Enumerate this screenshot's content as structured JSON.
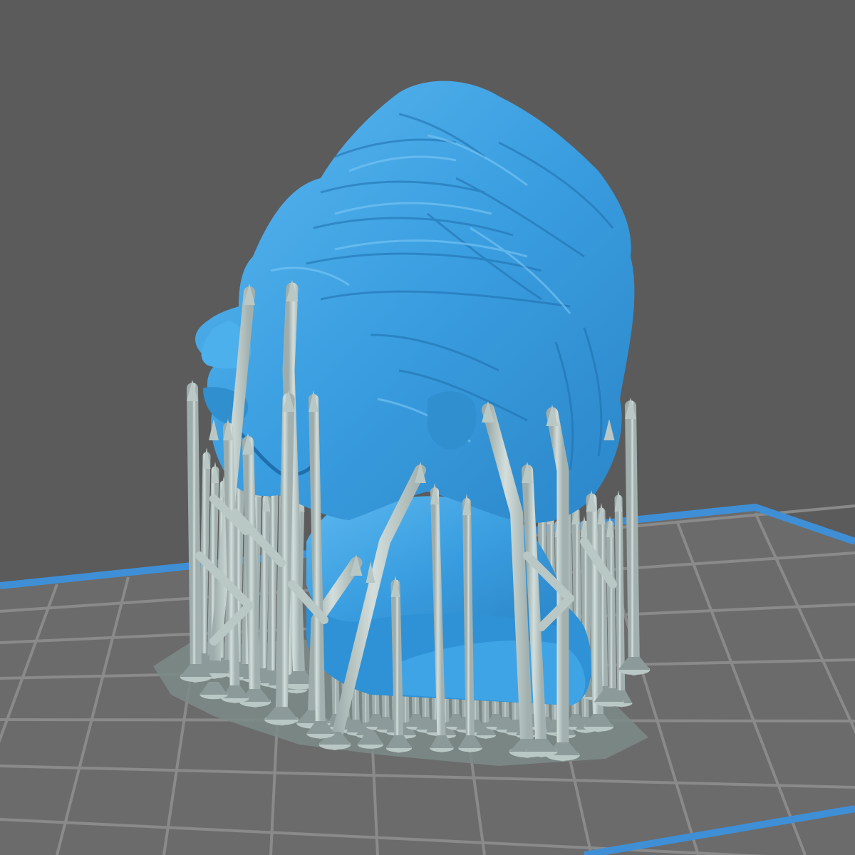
{
  "viewport": {
    "background": "#5b5b5b",
    "view": "perspective"
  },
  "build_plate": {
    "fill": "#6b6b6b",
    "grid_color": "#8a8a8a",
    "edge_color": "#3f8fd6",
    "grid": "on"
  },
  "model": {
    "name_icon": "bust-model",
    "color": "#3a9ee0",
    "shadow_color": "#1f6fae",
    "highlight_color": "#7cc8f5",
    "selected": false
  },
  "supports": {
    "color": "#b9c7c5",
    "shadow_color": "#8c9b99",
    "raft_color": "#7c8a86",
    "count_visible": 60
  }
}
